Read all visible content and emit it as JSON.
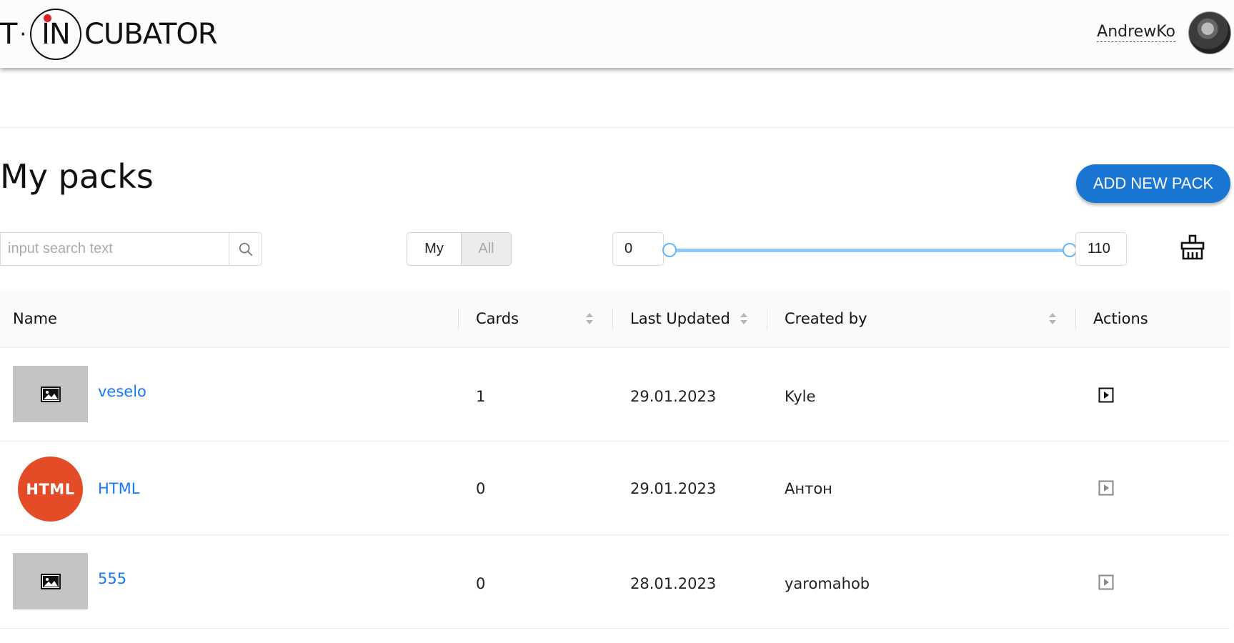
{
  "header": {
    "logo": {
      "t": "T",
      "dot": "·",
      "in": "IN",
      "rest": "CUBATOR"
    },
    "username": "AndrewKo"
  },
  "page": {
    "title": "My packs",
    "add_button_label": "ADD NEW PACK"
  },
  "filters": {
    "search_placeholder": "input search text",
    "search_value": "",
    "toggle": {
      "my_label": "My",
      "all_label": "All",
      "selected": "My"
    },
    "range": {
      "min": 0,
      "max": 110,
      "min_label": "0",
      "max_label": "110"
    }
  },
  "table": {
    "columns": {
      "name": "Name",
      "cards": "Cards",
      "last_updated": "Last Updated",
      "created_by": "Created by",
      "actions": "Actions"
    },
    "rows": [
      {
        "name": "veselo",
        "cards": "1",
        "updated": "29.01.2023",
        "author": "Kyle",
        "cover": "placeholder",
        "action_enabled": true
      },
      {
        "name": "HTML",
        "cards": "0",
        "updated": "29.01.2023",
        "author": "Антон",
        "cover": "html-logo",
        "cover_text": "HTML",
        "action_enabled": false
      },
      {
        "name": "555",
        "cards": "0",
        "updated": "28.01.2023",
        "author": "yaromahob",
        "cover": "placeholder",
        "action_enabled": false
      }
    ]
  },
  "colors": {
    "primary": "#1976d2",
    "link": "#1677ff",
    "slider": "#90caf9",
    "html_logo": "#e34c26"
  }
}
